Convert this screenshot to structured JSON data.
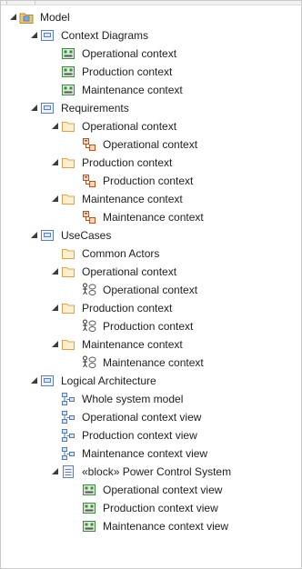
{
  "colors": {
    "folder": "#d9a44c",
    "package": "#5b82b8",
    "diagram_green": "#3d8a3d",
    "req": "#b5531d",
    "usecase": "#555555",
    "logical": "#4f7ab3",
    "block": "#6b7fa3"
  },
  "tree": [
    {
      "label": "Model",
      "icon": "model-root-icon",
      "level": 0,
      "expanded": true
    },
    {
      "label": "Context Diagrams",
      "icon": "package-icon",
      "level": 1,
      "expanded": true
    },
    {
      "label": "Operational context",
      "icon": "context-diagram-icon",
      "level": 2
    },
    {
      "label": "Production context",
      "icon": "context-diagram-icon",
      "level": 2
    },
    {
      "label": "Maintenance context",
      "icon": "context-diagram-icon",
      "level": 2
    },
    {
      "label": "Requirements",
      "icon": "package-icon",
      "level": 1,
      "expanded": true
    },
    {
      "label": "Operational context",
      "icon": "folder-icon",
      "level": 2,
      "expanded": true
    },
    {
      "label": "Operational context",
      "icon": "requirements-diagram-icon",
      "level": 3
    },
    {
      "label": "Production context",
      "icon": "folder-icon",
      "level": 2,
      "expanded": true
    },
    {
      "label": "Production context",
      "icon": "requirements-diagram-icon",
      "level": 3
    },
    {
      "label": "Maintenance context",
      "icon": "folder-icon",
      "level": 2,
      "expanded": true
    },
    {
      "label": "Maintenance context",
      "icon": "requirements-diagram-icon",
      "level": 3
    },
    {
      "label": "UseCases",
      "icon": "package-icon",
      "level": 1,
      "expanded": true
    },
    {
      "label": "Common Actors",
      "icon": "folder-icon",
      "level": 2
    },
    {
      "label": "Operational context",
      "icon": "folder-icon",
      "level": 2,
      "expanded": true
    },
    {
      "label": "Operational context",
      "icon": "use-case-diagram-icon",
      "level": 3
    },
    {
      "label": "Production context",
      "icon": "folder-icon",
      "level": 2,
      "expanded": true
    },
    {
      "label": "Production context",
      "icon": "use-case-diagram-icon",
      "level": 3
    },
    {
      "label": "Maintenance context",
      "icon": "folder-icon",
      "level": 2,
      "expanded": true
    },
    {
      "label": "Maintenance context",
      "icon": "use-case-diagram-icon",
      "level": 3
    },
    {
      "label": "Logical Architecture",
      "icon": "package-icon",
      "level": 1,
      "expanded": true
    },
    {
      "label": "Whole system model",
      "icon": "logical-diagram-icon",
      "level": 2
    },
    {
      "label": "Operational context view",
      "icon": "logical-diagram-icon",
      "level": 2
    },
    {
      "label": "Production context view",
      "icon": "logical-diagram-icon",
      "level": 2
    },
    {
      "label": "Maintenance context view",
      "icon": "logical-diagram-icon",
      "level": 2
    },
    {
      "label": "«block» Power Control System",
      "icon": "block-icon",
      "level": 2,
      "expanded": true
    },
    {
      "label": "Operational context view",
      "icon": "context-diagram-icon",
      "level": 3
    },
    {
      "label": "Production context view",
      "icon": "context-diagram-icon",
      "level": 3
    },
    {
      "label": "Maintenance context view",
      "icon": "context-diagram-icon",
      "level": 3
    }
  ]
}
